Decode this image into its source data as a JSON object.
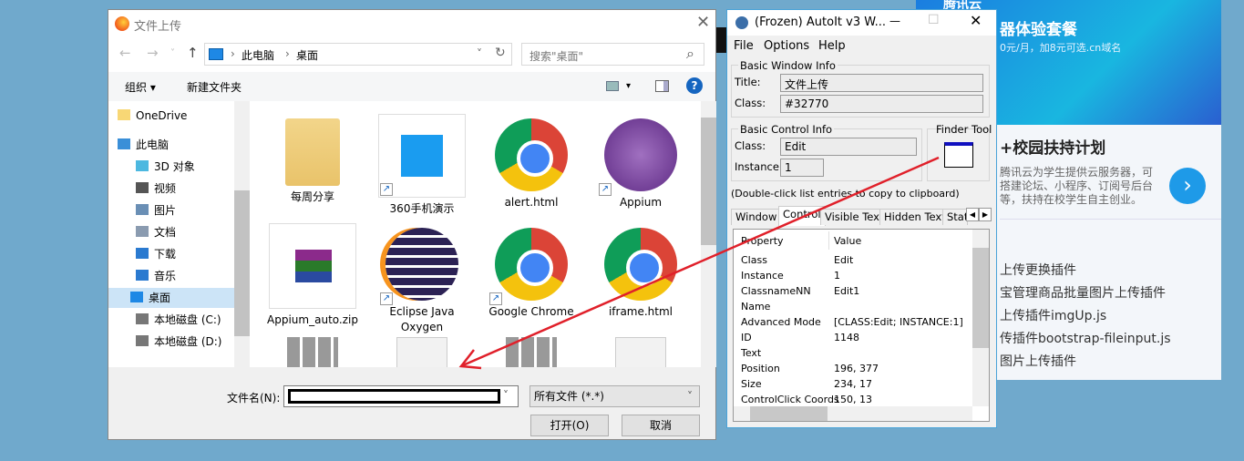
{
  "web": {
    "logo": "腾讯云",
    "banner_title": "器体验套餐",
    "banner_sub": "0元/月，加8元可选.cn域名",
    "heading": "+校园扶持计划",
    "desc": "腾讯云为学生提供云服务器，可搭建论坛、小程序、订阅号后台等，扶持在校学生自主创业。",
    "next": "›",
    "links": [
      "上传更换插件",
      "宝管理商品批量图片上传插件",
      "上传插件imgUp.js",
      "传插件bootstrap-fileinput.js",
      "图片上传插件"
    ]
  },
  "dialog": {
    "title": "文件上传",
    "close": "✕",
    "back": "←",
    "forward": "→",
    "recent": "˅",
    "up": "↑",
    "breadcrumb": [
      "此电脑",
      "桌面"
    ],
    "sep": "›",
    "refresh": "↻",
    "addr_drop": "˅",
    "search_placeholder": "搜索\"桌面\"",
    "search_icon": "⌕",
    "toolbar": {
      "organize": "组织 ▾",
      "new_folder": "新建文件夹",
      "view": "▾",
      "help": "?"
    },
    "sidebar": [
      {
        "label": "OneDrive",
        "icon": "folder-icon",
        "color": "#f8d775"
      },
      {
        "label": "此电脑",
        "icon": "computer-icon",
        "color": "#3a8fd8"
      },
      {
        "label": "3D 对象",
        "icon": "cube-icon",
        "color": "#4cb8e0"
      },
      {
        "label": "视频",
        "icon": "video-icon",
        "color": "#555"
      },
      {
        "label": "图片",
        "icon": "pictures-icon",
        "color": "#6a8fb5"
      },
      {
        "label": "文档",
        "icon": "documents-icon",
        "color": "#8a9bb0"
      },
      {
        "label": "下载",
        "icon": "download-icon",
        "color": "#2a7ad0"
      },
      {
        "label": "音乐",
        "icon": "music-icon",
        "color": "#2a7ad0"
      },
      {
        "label": "桌面",
        "icon": "desktop-icon",
        "color": "#1e88e5",
        "selected": true
      },
      {
        "label": "本地磁盘 (C:)",
        "icon": "drive-icon",
        "color": "#777"
      },
      {
        "label": "本地磁盘 (D:)",
        "icon": "drive-icon",
        "color": "#777"
      }
    ],
    "files": [
      {
        "label": "每周分享",
        "type": "folder"
      },
      {
        "label": "360手机演示",
        "type": "app",
        "shortcut": true
      },
      {
        "label": "alert.html",
        "type": "chrome"
      },
      {
        "label": "Appium",
        "type": "appium",
        "shortcut": true
      },
      {
        "label": "Appium_auto.zip",
        "type": "rar"
      },
      {
        "label": "Eclipse Java Oxygen",
        "type": "eclipse",
        "shortcut": true
      },
      {
        "label": "Google Chrome",
        "type": "chrome",
        "shortcut": true
      },
      {
        "label": "iframe.html",
        "type": "chrome"
      },
      {
        "label": "",
        "type": "sheet"
      },
      {
        "label": "",
        "type": "doc"
      },
      {
        "label": "",
        "type": "sheet"
      },
      {
        "label": "",
        "type": "text"
      }
    ],
    "filename_label": "文件名(N):",
    "filename_value": "",
    "filetype": "所有文件 (*.*)",
    "open": "打开(O)",
    "cancel": "取消"
  },
  "autoit": {
    "title": "(Frozen) AutoIt v3 W...",
    "min": "—",
    "max": "☐",
    "close": "✕",
    "menu": [
      "File",
      "Options",
      "Help"
    ],
    "basic_window": "Basic Window Info",
    "title_label": "Title:",
    "title_value": "文件上传",
    "class_label": "Class:",
    "class_value": "#32770",
    "basic_control": "Basic Control Info",
    "ctrl_class_label": "Class:",
    "ctrl_class_value": "Edit",
    "instance_label": "Instance:",
    "instance_value": "1",
    "finder": "Finder Tool",
    "hint": "(Double-click list entries to copy to clipboard)",
    "tabs": [
      "Window",
      "Control",
      "Visible Text",
      "Hidden Text",
      "Stat"
    ],
    "active_tab": "Control",
    "columns": [
      "Property",
      "Value"
    ],
    "rows": [
      [
        "Class",
        "Edit"
      ],
      [
        "Instance",
        "1"
      ],
      [
        "ClassnameNN",
        "Edit1"
      ],
      [
        "Name",
        ""
      ],
      [
        "Advanced Mode",
        "[CLASS:Edit; INSTANCE:1]"
      ],
      [
        "ID",
        "1148"
      ],
      [
        "Text",
        ""
      ],
      [
        "Position",
        "196, 377"
      ],
      [
        "Size",
        "234, 17"
      ],
      [
        "ControlClick Coords",
        "150, 13"
      ]
    ]
  },
  "annotation_color": "#e0202a"
}
